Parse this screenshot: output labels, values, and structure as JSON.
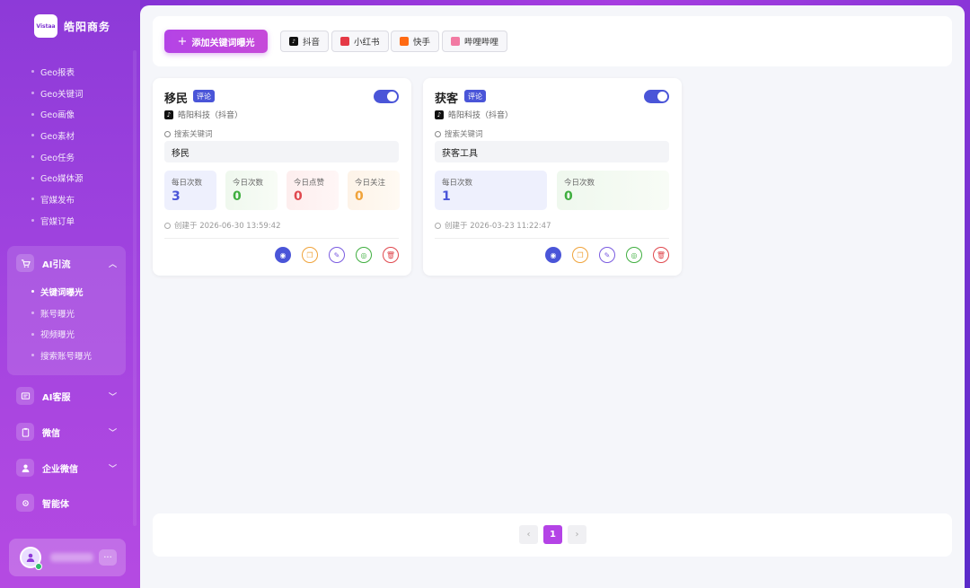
{
  "brand": {
    "logo_text": "Vistaa",
    "name": "皓阳商务"
  },
  "sidebar": {
    "geo_items": [
      "Geo报表",
      "Geo关键词",
      "Geo画像",
      "Geo素材",
      "Geo任务",
      "Geo媒体源",
      "官媒发布",
      "官媒订单"
    ],
    "ai_traffic": {
      "label": "AI引流",
      "items": [
        "关键词曝光",
        "账号曝光",
        "视频曝光",
        "搜索账号曝光"
      ],
      "active": "关键词曝光"
    },
    "menus": [
      {
        "label": "AI客服",
        "icon": "chat-icon"
      },
      {
        "label": "微信",
        "icon": "clipboard-icon"
      },
      {
        "label": "企业微信",
        "icon": "user-icon"
      },
      {
        "label": "智能体",
        "icon": "agent-icon"
      }
    ],
    "more_label": "···"
  },
  "toolbar": {
    "add_label": "添加关键词曝光",
    "platforms": [
      {
        "label": "抖音",
        "color": "#111111"
      },
      {
        "label": "小红书",
        "color": "#e53946"
      },
      {
        "label": "快手",
        "color": "#ff6a13"
      },
      {
        "label": "哔哩哔哩",
        "color": "#f27aa3"
      }
    ]
  },
  "cards": [
    {
      "title": "移民",
      "tag": "评论",
      "account": "皓阳科技（抖音）",
      "kw_label": "搜索关键词",
      "keyword": "移民",
      "stats": [
        {
          "label": "每日次数",
          "value": "3"
        },
        {
          "label": "今日次数",
          "value": "0"
        },
        {
          "label": "今日点赞",
          "value": "0"
        },
        {
          "label": "今日关注",
          "value": "0"
        }
      ],
      "created": "创建于 2026-06-30 13:59:42"
    },
    {
      "title": "获客",
      "tag": "评论",
      "account": "皓阳科技（抖音）",
      "kw_label": "搜索关键词",
      "keyword": "获客工具",
      "stats": [
        {
          "label": "每日次数",
          "value": "1"
        },
        {
          "label": "今日次数",
          "value": "0"
        }
      ],
      "created": "创建于 2026-03-23 11:22:47"
    }
  ],
  "pagination": {
    "prev": "‹",
    "current": "1",
    "next": "›"
  },
  "colors": {
    "accent": "#4a55d8",
    "brand": "#b443e6",
    "green": "#3fae3f",
    "red": "#e0484e",
    "orange": "#f0a33a"
  }
}
